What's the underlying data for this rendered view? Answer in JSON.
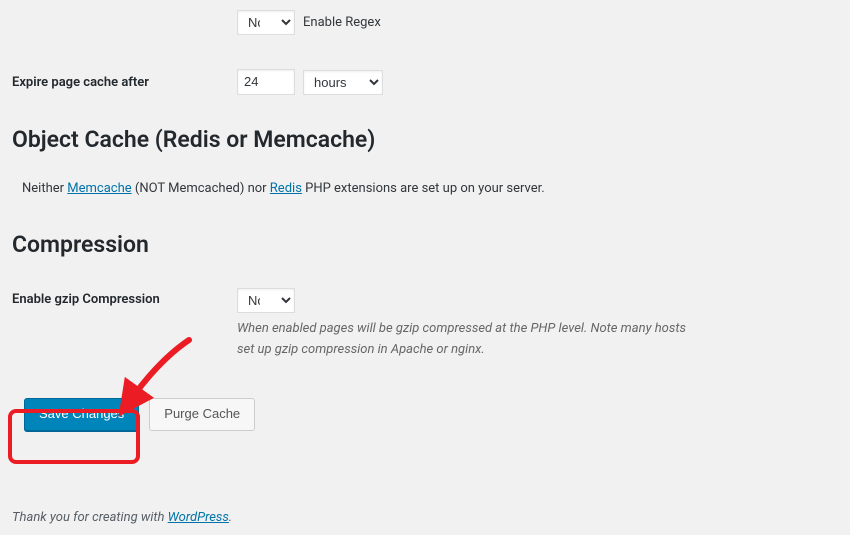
{
  "regex_row": {
    "value": "No",
    "label": "Enable Regex"
  },
  "expire_row": {
    "label": "Expire page cache after",
    "value": "24",
    "unit": "hours"
  },
  "object_cache": {
    "heading": "Object Cache (Redis or Memcache)",
    "text_pre": "Neither ",
    "memcache_link": "Memcache",
    "text_mid1": " (NOT Memcached) nor ",
    "redis_link": "Redis",
    "text_post": " PHP extensions are set up on your server."
  },
  "compression": {
    "heading": "Compression",
    "gzip_label": "Enable gzip Compression",
    "gzip_value": "No",
    "description": "When enabled pages will be gzip compressed at the PHP level. Note many hosts set up gzip compression in Apache or nginx."
  },
  "buttons": {
    "save": "Save Changes",
    "purge": "Purge Cache"
  },
  "footer": {
    "thanks_pre": "Thank you for creating with ",
    "wp_link": "WordPress",
    "thanks_post": "."
  }
}
